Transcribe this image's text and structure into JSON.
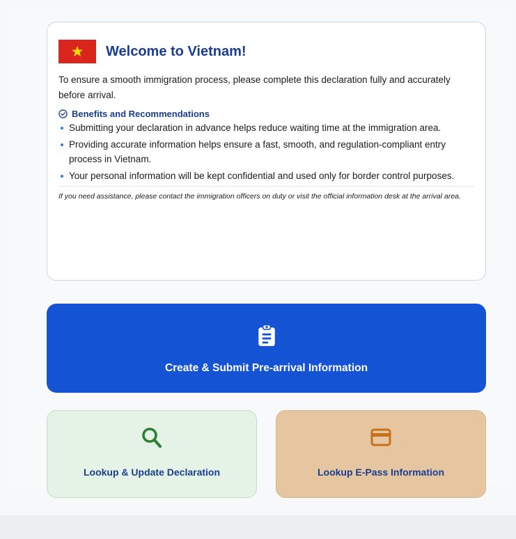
{
  "welcome": {
    "title": "Welcome to Vietnam!",
    "intro": "To ensure a smooth immigration process, please complete this declaration fully and accurately before arrival.",
    "benefits_heading": "Benefits and Recommendations",
    "benefits": [
      "Submitting your declaration in advance helps reduce waiting time at the immigration area.",
      "Providing accurate information helps ensure a fast, smooth, and regulation-compliant entry process in Vietnam.",
      "Your personal information will be kept confidential and used only for border control purposes."
    ],
    "assist_note": "If you need assistance, please contact the immigration officers on duty or visit the official information desk at the arrival area."
  },
  "actions": {
    "create_label": "Create & Submit Pre-arrival Information",
    "lookup_label": "Lookup & Update Declaration",
    "epass_label": "Lookup E-Pass Information"
  },
  "icons": {
    "flag": "vietnam-flag-icon",
    "check": "check-circle-icon",
    "create": "clipboard-icon",
    "lookup": "search-icon",
    "epass": "card-icon"
  },
  "colors": {
    "brand_blue": "#1453d4",
    "title_blue": "#1a3d8f",
    "flag_red": "#da251d",
    "flag_star": "#ffde00",
    "lookup_bg": "#e5f3e6",
    "lookup_icon": "#2e7d32",
    "epass_bg": "#e5c6a0",
    "epass_icon": "#c7711a"
  }
}
